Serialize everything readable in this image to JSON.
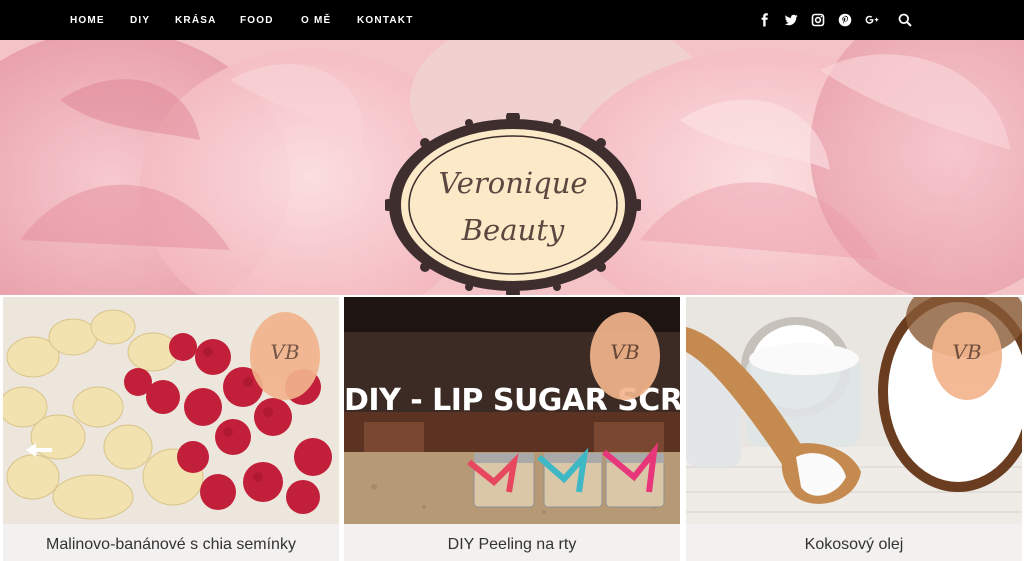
{
  "nav": {
    "links": [
      "HOME",
      "DIY",
      "KRÁSA",
      "FOOD",
      "O MĚ",
      "KONTAKT"
    ],
    "social_icons": [
      "facebook-icon",
      "twitter-icon",
      "instagram-icon",
      "pinterest-icon",
      "google-plus-icon",
      "search-icon"
    ]
  },
  "header": {
    "logo_line1": "Veronique",
    "logo_line2": "Beauty"
  },
  "cards": [
    {
      "title": "Malinovo-banánové s chia semínky",
      "badge": "VB"
    },
    {
      "title": "DIY Peeling na rty",
      "badge": "VB",
      "image_text": "DIY - LIP SUGAR SCRUBS"
    },
    {
      "title": "Kokosový olej",
      "badge": "VB"
    }
  ],
  "slider": {
    "prev_icon": "arrow-left-icon",
    "next_icon": "arrow-right-icon"
  },
  "colors": {
    "nav_bg": "#000000",
    "card_title_bg": "#f2f1ef",
    "badge": "#f2b48c",
    "logo_oval": "#fbe9c8"
  }
}
